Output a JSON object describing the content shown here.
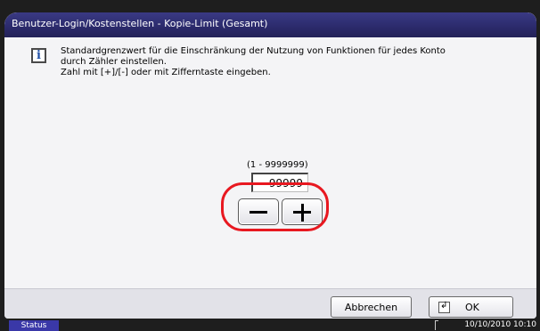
{
  "header": {
    "title": "Benutzer-Login/Kostenstellen - Kopie-Limit (Gesamt)"
  },
  "info": {
    "icon": "info-icon",
    "glyph": "i",
    "lines": [
      "Standardgrenzwert für die Einschränkung der Nutzung von Funktionen für jedes Konto",
      "durch Zähler einstellen.",
      "Zahl mit [+]/[-] oder mit Zifferntaste eingeben."
    ]
  },
  "limit": {
    "range": "(1 - 9999999)",
    "value": "99999",
    "minus_icon": "minus-icon",
    "plus_icon": "plus-icon",
    "highlight_color": "#e81820"
  },
  "footer": {
    "cancel_label": "Abbrechen",
    "ok_label": "OK",
    "ok_icon": "enter-icon",
    "enter_glyph": "↲"
  },
  "statusbar": {
    "status_label": "Status",
    "datetime": "10/10/2010  10:10"
  },
  "colors": {
    "titlebar": "#2c2b6d",
    "status_tab": "#3a38a8",
    "panel": "#f4f4f6"
  }
}
